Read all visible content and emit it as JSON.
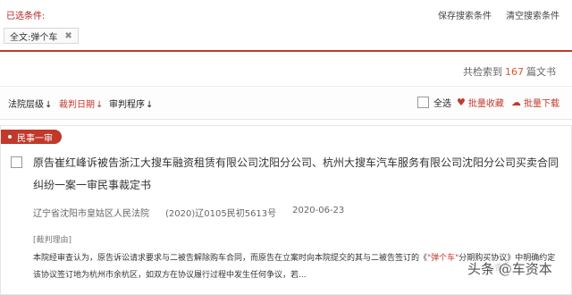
{
  "filter": {
    "title": "已选条件:",
    "save_search": "保存搜索条件",
    "clear_search": "清空搜索条件",
    "chip_label": "全文:",
    "chip_value": "弹个车",
    "chip_close": "✖"
  },
  "results": {
    "prefix": "共检索到",
    "count": "167",
    "suffix": "篇文书"
  },
  "sort": {
    "court_level": "法院层级",
    "judge_date": "裁判日期",
    "trial_procedure": "审判程序",
    "arrow": "↓",
    "select_all": "全选",
    "batch_collect": "批量收藏",
    "batch_download": "批量下载"
  },
  "case": {
    "tag": "民事一审",
    "title": "原告崔红峰诉被告浙江大搜车融资租赁有限公司沈阳分公司、杭州大搜车汽车服务有限公司沈阳分公司买卖合同纠纷一案一审民事裁定书",
    "court": "辽宁省沈阳市皇姑区人民法院",
    "case_no": "(2020)辽0105民初5613号",
    "date": "2020-06-23",
    "reason_label": "[裁判理由]",
    "snippet_before": "本院经审查认为，原告诉讼请求要求与二被告解除购车合同，而原告在立案时向本院提交的其与二被告签订的《",
    "snippet_highlight": "\"弹个车\"",
    "snippet_after": "分期购买协议》中明确约定该协议签订地为杭州市余杭区，如双方在协议履行过程中发生任何争议，若..."
  },
  "watermark": {
    "text": "头条 @车资本",
    "faint": "车资本"
  },
  "colors": {
    "accent": "#c0392b",
    "count": "#d05a2c"
  }
}
